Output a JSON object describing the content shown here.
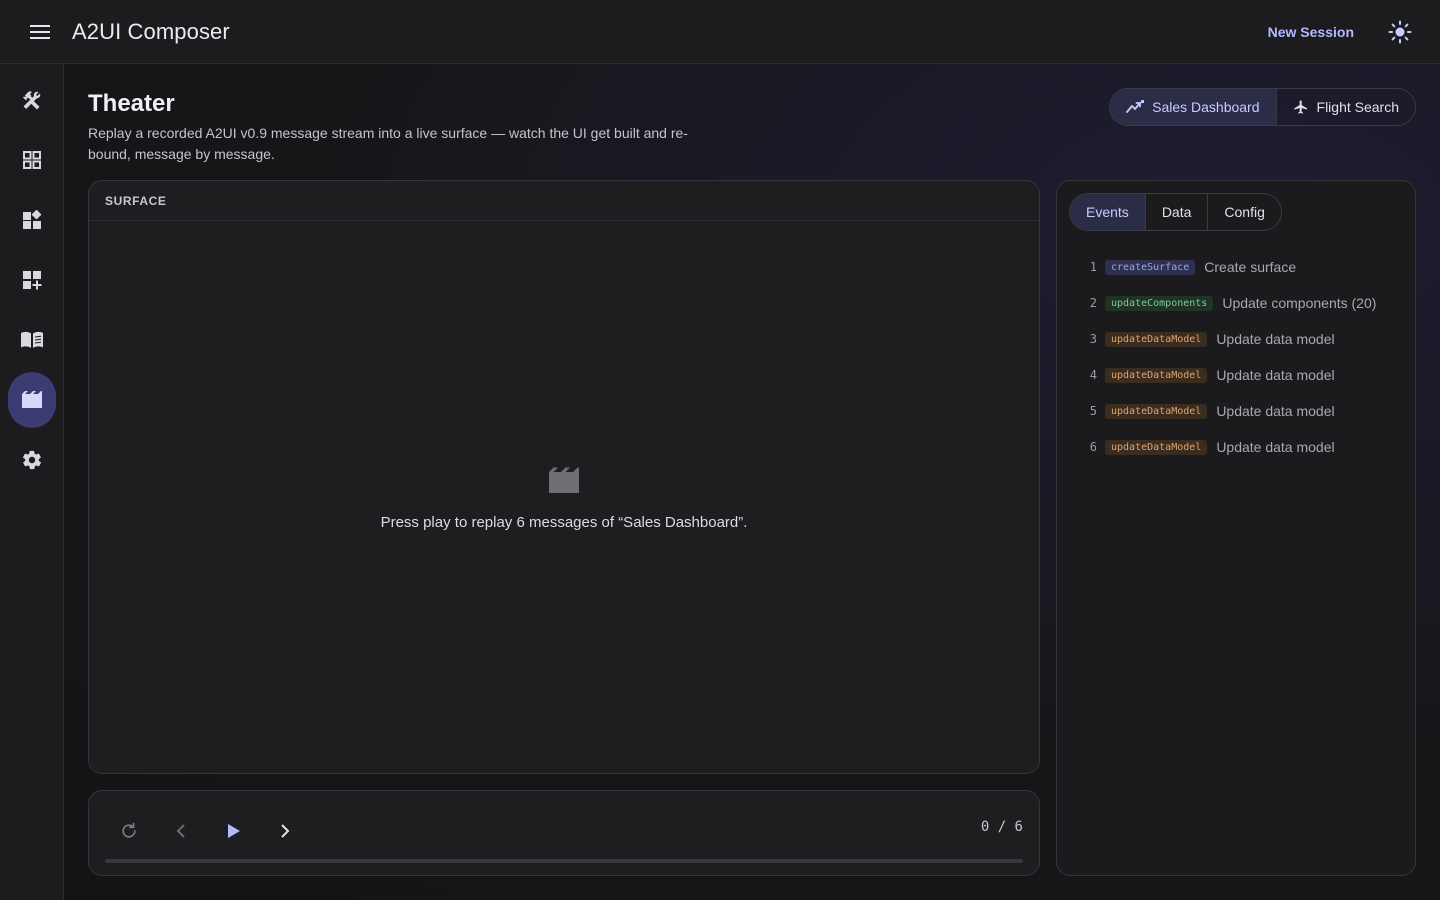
{
  "app": {
    "title": "A2UI Composer",
    "new_session": "New Session"
  },
  "rail": {
    "items": [
      {
        "name": "tools",
        "icon": "tools-icon"
      },
      {
        "name": "gallery",
        "icon": "grid-icon"
      },
      {
        "name": "widgets",
        "icon": "widgets-icon"
      },
      {
        "name": "components",
        "icon": "dashboard-add-icon"
      },
      {
        "name": "docs",
        "icon": "book-icon"
      },
      {
        "name": "theater",
        "icon": "clapperboard-icon",
        "active": true
      },
      {
        "name": "settings",
        "icon": "gear-icon"
      }
    ]
  },
  "page": {
    "title": "Theater",
    "description": "Replay a recorded A2UI v0.9 message stream into a live surface — watch the UI get built and re-bound, message by message."
  },
  "scenarios": [
    {
      "label": "Sales Dashboard",
      "icon": "trending-icon",
      "active": true
    },
    {
      "label": "Flight Search",
      "icon": "plane-icon",
      "active": false
    }
  ],
  "surface": {
    "label": "SURFACE",
    "empty_message": "Press play to replay 6 messages of “Sales Dashboard”."
  },
  "player": {
    "counter": "0 / 6",
    "progress": 0
  },
  "panel": {
    "tabs": [
      {
        "label": "Events",
        "active": true
      },
      {
        "label": "Data",
        "active": false
      },
      {
        "label": "Config",
        "active": false
      }
    ],
    "events": [
      {
        "num": "1",
        "type": "createSurface",
        "label": "Create surface"
      },
      {
        "num": "2",
        "type": "updateComponents",
        "label": "Update components (20)"
      },
      {
        "num": "3",
        "type": "updateDataModel",
        "label": "Update data model"
      },
      {
        "num": "4",
        "type": "updateDataModel",
        "label": "Update data model"
      },
      {
        "num": "5",
        "type": "updateDataModel",
        "label": "Update data model"
      },
      {
        "num": "6",
        "type": "updateDataModel",
        "label": "Update data model"
      }
    ]
  },
  "colors": {
    "accent": "#b4b9ff",
    "createSurface": {
      "bg": "#2e3050",
      "fg": "#9ea3e8"
    },
    "updateComponents": {
      "bg": "#1f3326",
      "fg": "#7fc996"
    },
    "updateDataModel": {
      "bg": "#3a2c1e",
      "fg": "#e0a470"
    }
  }
}
